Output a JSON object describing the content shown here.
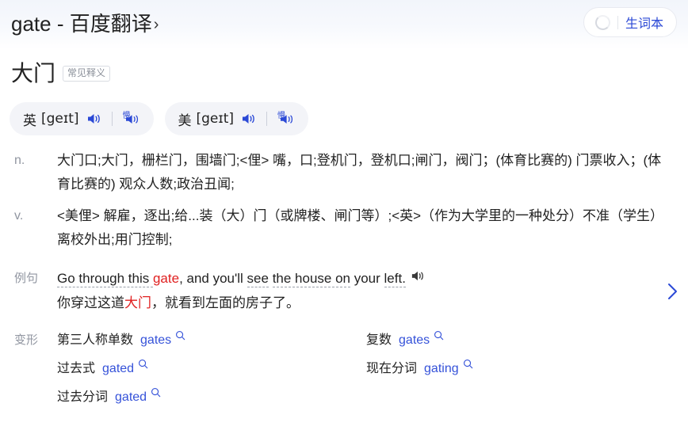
{
  "header": {
    "title": "gate - 百度翻译",
    "chevron": "›",
    "vocab_button_label": "生词本",
    "spinner_icon": "loading-spinner-icon"
  },
  "headword": {
    "text": "大门",
    "badge": "常见释义"
  },
  "phonetics": [
    {
      "region": "英",
      "ipa": "[geɪt]",
      "play_icon": "speaker-icon",
      "slow_icon": "slow-speaker-icon",
      "slow_char": "慢"
    },
    {
      "region": "美",
      "ipa": "[geɪt]",
      "play_icon": "speaker-icon",
      "slow_icon": "slow-speaker-icon",
      "slow_char": "慢"
    }
  ],
  "senses": [
    {
      "pos": "n.",
      "definition": "大门口;大门，栅栏门，围墙门;<俚> 嘴，口;登机门，登机口;闸门，阀门；(体育比赛的) 门票收入；(体育比赛的) 观众人数;政治丑闻;"
    },
    {
      "pos": "v.",
      "definition": "<美俚> 解雇，逐出;给...装（大）门（或牌楼、闸门等）;<英>（作为大学里的一种处分）不准（学生）离校外出;用门控制;"
    }
  ],
  "example": {
    "label": "例句",
    "en_parts": [
      {
        "text": "Go through this ",
        "underline": true,
        "highlight": false
      },
      {
        "text": "gate",
        "underline": false,
        "highlight": true
      },
      {
        "text": ", and you'll ",
        "underline": false,
        "highlight": false
      },
      {
        "text": "see",
        "underline": true,
        "highlight": false
      },
      {
        "text": " ",
        "underline": false,
        "highlight": false
      },
      {
        "text": "the house on",
        "underline": true,
        "highlight": false
      },
      {
        "text": " your ",
        "underline": false,
        "highlight": false
      },
      {
        "text": "left.",
        "underline": true,
        "highlight": false
      }
    ],
    "en_plain": "Go through this gate, and you'll see the house on your left.",
    "play_icon": "speaker-icon",
    "zh_parts": [
      {
        "text": "你穿过这道",
        "highlight": false
      },
      {
        "text": "大门",
        "highlight": true
      },
      {
        "text": "，就看到左面的房子了。",
        "highlight": false
      }
    ],
    "zh_plain": "你穿过这道大门，就看到左面的房子了。",
    "next_icon": "chevron-right-icon"
  },
  "inflections": {
    "label": "变形",
    "search_icon": "search-icon",
    "items": [
      {
        "name": "第三人称单数",
        "value": "gates"
      },
      {
        "name": "复数",
        "value": "gates"
      },
      {
        "name": "过去式",
        "value": "gated"
      },
      {
        "name": "现在分词",
        "value": "gating"
      },
      {
        "name": "过去分词",
        "value": "gated"
      }
    ]
  },
  "colors": {
    "link_blue": "#2b49d6",
    "inflection_blue": "#3552d9",
    "highlight_red": "#e02020",
    "muted_gray": "#9196a1",
    "pill_bg": "#f3f4f8"
  }
}
